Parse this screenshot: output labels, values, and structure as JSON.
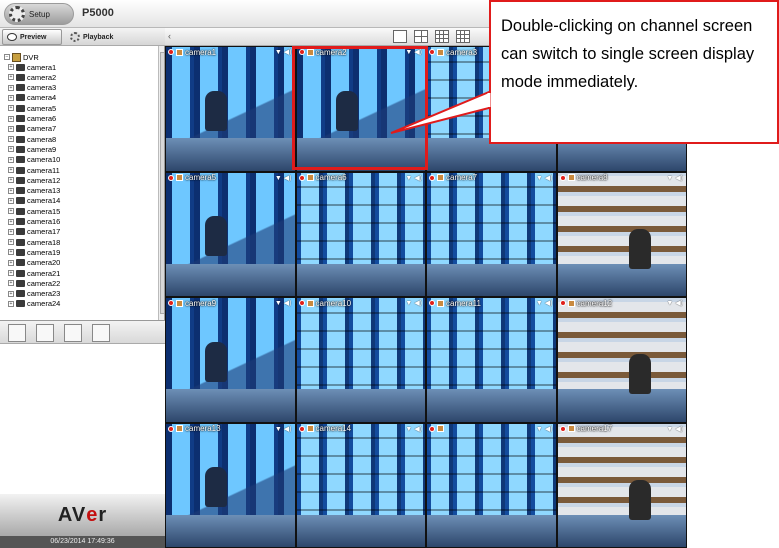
{
  "topbar": {
    "setup_label": "Setup",
    "title": "P5000"
  },
  "tabs": [
    {
      "label": "Preview"
    },
    {
      "label": "Playback"
    }
  ],
  "tree": {
    "root": "DVR",
    "cameras": [
      "camera1",
      "camera2",
      "camera3",
      "camera4",
      "camera5",
      "camera6",
      "camera7",
      "camera8",
      "camera9",
      "camera10",
      "camera11",
      "camera12",
      "camera13",
      "camera14",
      "camera15",
      "camera16",
      "camera17",
      "camera18",
      "camera19",
      "camera20",
      "camera21",
      "camera22",
      "camera23",
      "camera24"
    ]
  },
  "logo": {
    "prefix": "AV",
    "accent": "e",
    "suffix": "r"
  },
  "clock": "06/23/2014 17:49:36",
  "grid": {
    "cells": [
      {
        "name": "camera1",
        "scene": "a"
      },
      {
        "name": "camera2",
        "scene": "a"
      },
      {
        "name": "camera3",
        "scene": "b"
      },
      {
        "name": "",
        "scene": "c"
      },
      {
        "name": "camera5",
        "scene": "a"
      },
      {
        "name": "camera6",
        "scene": "b"
      },
      {
        "name": "camera7",
        "scene": "b"
      },
      {
        "name": "camera8",
        "scene": "c"
      },
      {
        "name": "camera9",
        "scene": "a"
      },
      {
        "name": "camera10",
        "scene": "b"
      },
      {
        "name": "camera11",
        "scene": "b"
      },
      {
        "name": "camera12",
        "scene": "c"
      },
      {
        "name": "camera13",
        "scene": "a"
      },
      {
        "name": "camera14",
        "scene": "b"
      },
      {
        "name": "",
        "scene": "b"
      },
      {
        "name": "camera17",
        "scene": "c"
      }
    ]
  },
  "callout": "Double-clicking on channel screen can switch to single screen display mode immediately.",
  "colors": {
    "accent": "#e01b1b"
  }
}
